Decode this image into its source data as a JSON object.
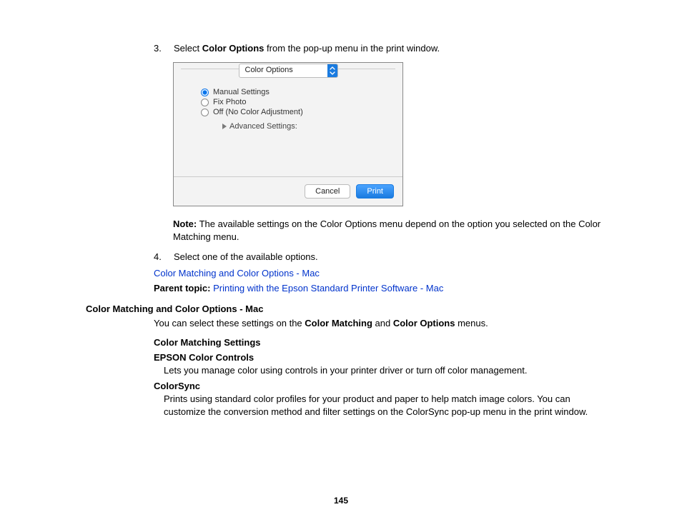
{
  "steps": {
    "s3": {
      "num": "3.",
      "prefix": "Select ",
      "bold": "Color Options",
      "suffix": " from the pop-up menu in the print window."
    },
    "s4": {
      "num": "4.",
      "text": "Select one of the available options."
    }
  },
  "shot": {
    "dropdown": "Color Options",
    "radio1": "Manual Settings",
    "radio2": "Fix Photo",
    "radio3": "Off (No Color Adjustment)",
    "advanced": "Advanced Settings:",
    "cancel": "Cancel",
    "print": "Print"
  },
  "note": {
    "label": "Note:",
    "text": " The available settings on the Color Options menu depend on the option you selected on the Color Matching menu."
  },
  "link1": "Color Matching and Color Options - Mac",
  "parent": {
    "label": "Parent topic:",
    "link": " Printing with the Epson Standard Printer Software - Mac"
  },
  "section": {
    "heading": "Color Matching and Color Options - Mac",
    "intro_pre": "You can select these settings on the ",
    "intro_b1": "Color Matching",
    "intro_mid": " and ",
    "intro_b2": "Color Options",
    "intro_post": " menus.",
    "sub1": "Color Matching Settings",
    "dt1": "EPSON Color Controls",
    "dd1": "Lets you manage color using controls in your printer driver or turn off color management.",
    "dt2": "ColorSync",
    "dd2": "Prints using standard color profiles for your product and paper to help match image colors. You can customize the conversion method and filter settings on the ColorSync pop-up menu in the print window."
  },
  "pagenum": "145"
}
